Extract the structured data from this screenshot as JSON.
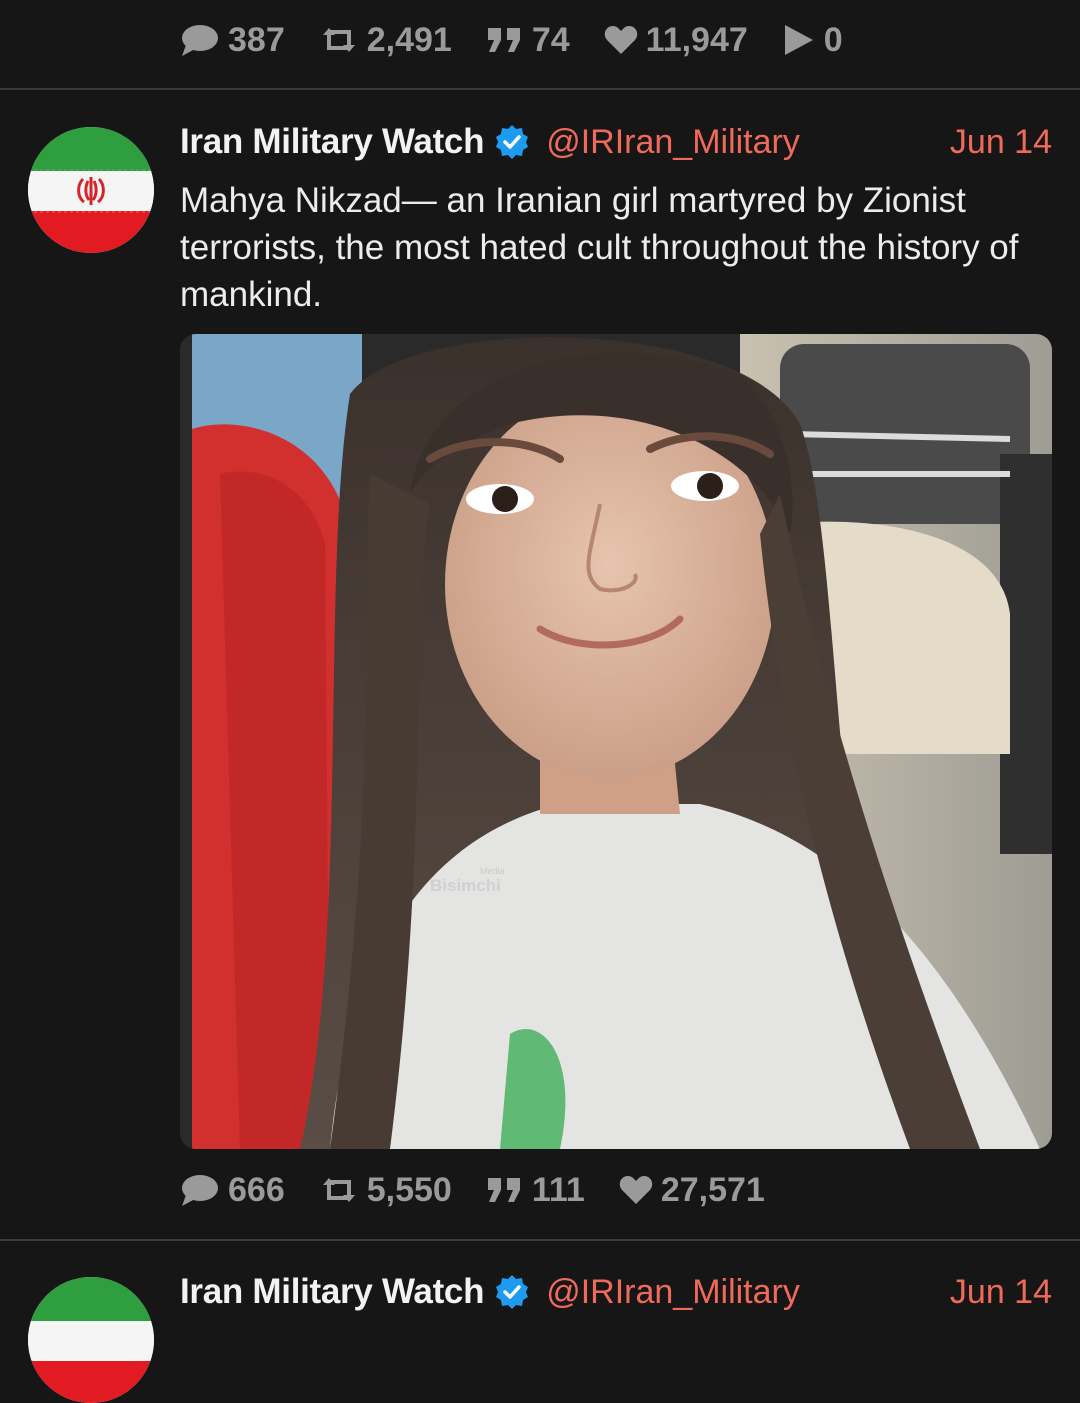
{
  "prev_post": {
    "stats": {
      "replies": "387",
      "retweets": "2,491",
      "quotes": "74",
      "likes": "11,947",
      "views": "0"
    }
  },
  "post": {
    "author": "Iran Military Watch",
    "handle": "@IRIran_Military",
    "date": "Jun 14",
    "text": "Mahya Nikzad— an Iranian girl martyred by Zionist terrorists, the most hated cult throughout the history of mankind.",
    "image": {
      "watermark_small": "Media",
      "watermark": "Bisimchi"
    },
    "stats": {
      "replies": "666",
      "retweets": "5,550",
      "quotes": "111",
      "likes": "27,571"
    }
  },
  "next_post": {
    "author": "Iran Military Watch",
    "handle": "@IRIran_Military",
    "date": "Jun 14"
  },
  "colors": {
    "accent": "#f06a5a",
    "verified": "#1d9bf0",
    "background": "#161616",
    "muted": "#9a9a9a"
  }
}
